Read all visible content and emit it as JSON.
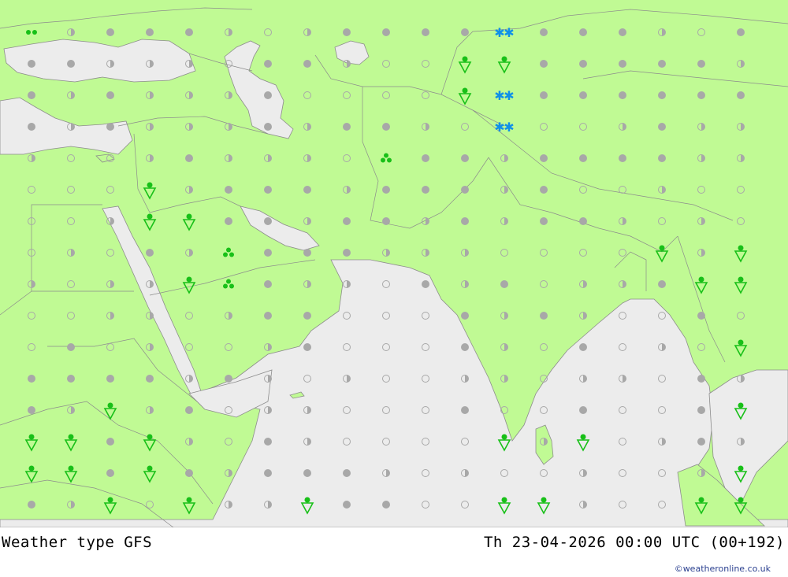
{
  "title": "Weather type",
  "model": "GFS",
  "valid_time": "Th 23-04-2026 00:00 UTC (00+192)",
  "credit": "©weatheronline.co.uk",
  "colors": {
    "land": "#c0fa94",
    "sea": "#ececec",
    "border": "#8c8c8c",
    "symbol_gray": "#a8a8a8",
    "rain": "#18c018",
    "snow": "#1090e8"
  },
  "legend_symbols": {
    "o": "clear-icon",
    "h": "partly-cloudy-icon",
    "f": "overcast-icon",
    "d": "drizzle-icon",
    "r": "rain-shower-icon",
    "t": "thunder-showers-icon",
    "s": "snow-icon"
  },
  "grid": {
    "cols": 19,
    "rows": 16,
    "cells": [
      "dhfffhohffffsfffhof",
      "ffhhhoffhoorrfffffh",
      "fhfhhhfoooorsffffff",
      "fhfhhhfhffhosoohfhh",
      "hoohfhhhotffhffffhh",
      "ooorhfffhfffhfoohoo",
      "oohrrffhffhfhffhoho",
      "ohofhtfffhhhoooorhr",
      "hohhrtfhhofhfohhfrr",
      "oohhohffooofhfhoofo",
      "ofohoohfooofhofohor",
      "ffffhfhohoohhohhofh",
      "fhrhfohhooofoofoofr",
      "rrfrhofhoooorhrohfh",
      "rrfrfhfffhohoohoohr",
      "fhrorhhrffoorrhoorr"
    ]
  }
}
